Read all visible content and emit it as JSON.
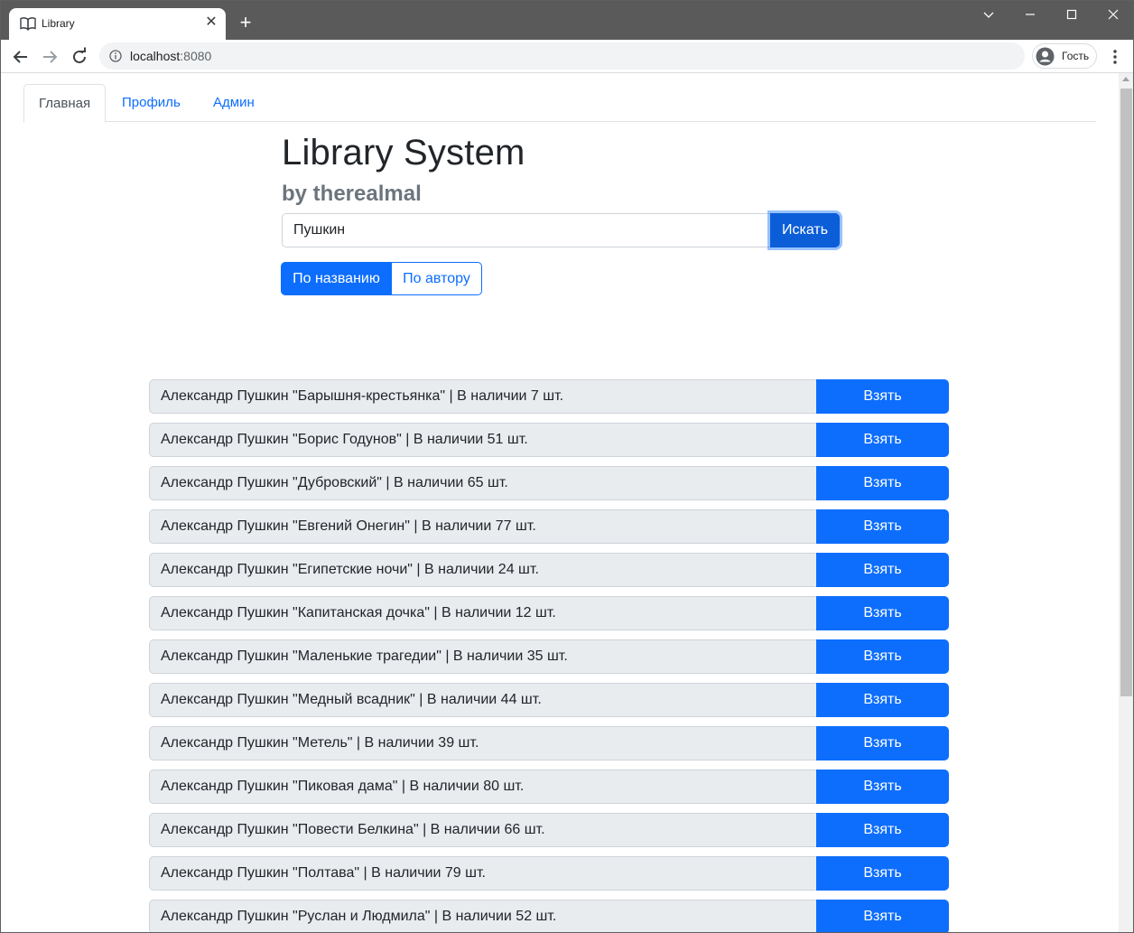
{
  "browser": {
    "tab_title": "Library",
    "url_host": "localhost",
    "url_port": ":8080",
    "profile_label": "Гость"
  },
  "nav": {
    "tabs": [
      {
        "label": "Главная",
        "active": true
      },
      {
        "label": "Профиль",
        "active": false
      },
      {
        "label": "Админ",
        "active": false
      }
    ]
  },
  "header": {
    "title": "Library System",
    "subtitle": "by therealmal"
  },
  "search": {
    "value": "Пушкин",
    "button_label": "Искать",
    "mode_title": "По названию",
    "mode_author": "По автору",
    "active_mode": "title"
  },
  "books": {
    "action_label": "Взять",
    "items": [
      "Александр Пушкин \"Барышня-крестьянка\" | В наличии 7 шт.",
      "Александр Пушкин \"Борис Годунов\" | В наличии 51 шт.",
      "Александр Пушкин \"Дубровский\" | В наличии 65 шт.",
      "Александр Пушкин \"Евгений Онегин\" | В наличии 77 шт.",
      "Александр Пушкин \"Египетские ночи\" | В наличии 24 шт.",
      "Александр Пушкин \"Капитанская дочка\" | В наличии 12 шт.",
      "Александр Пушкин \"Маленькие трагедии\" | В наличии 35 шт.",
      "Александр Пушкин \"Медный всадник\" | В наличии 44 шт.",
      "Александр Пушкин \"Метель\" | В наличии 39 шт.",
      "Александр Пушкин \"Пиковая дама\" | В наличии 80 шт.",
      "Александр Пушкин \"Повести Белкина\" | В наличии 66 шт.",
      "Александр Пушкин \"Полтава\" | В наличии 79 шт.",
      "Александр Пушкин \"Руслан и Людмила\" | В наличии 52 шт."
    ]
  },
  "colors": {
    "primary": "#0d6efd",
    "primary_active": "#0b5ed7",
    "row_bg": "#e9ecef",
    "chrome_titlebar": "#5a5a5a"
  }
}
